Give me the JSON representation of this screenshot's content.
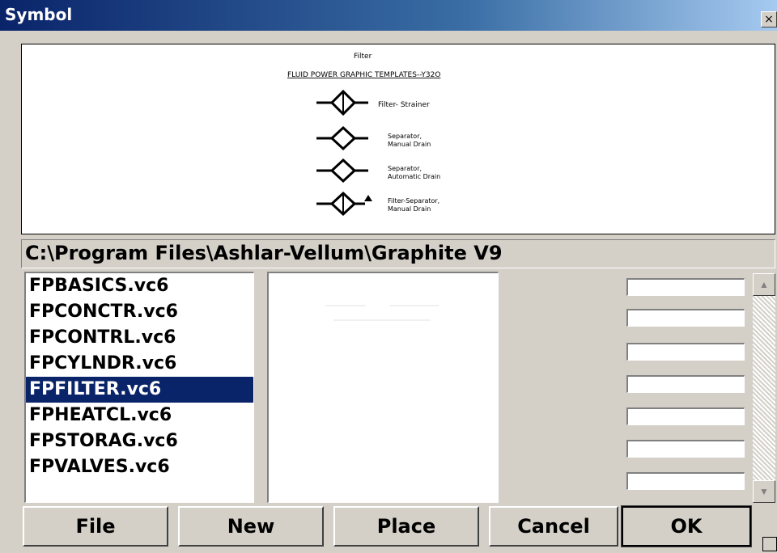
{
  "window": {
    "title": "Symbol",
    "close_label": "×"
  },
  "preview": {
    "heading": "Filter",
    "subheading": "FLUID POWER GRAPHIC TEMPLATES--Y32O",
    "symbols": [
      {
        "label_lines": [
          "Filter- Strainer"
        ]
      },
      {
        "label_lines": [
          "Separator,",
          "Manual Drain"
        ]
      },
      {
        "label_lines": [
          "Separator,",
          "Automatic Drain"
        ]
      },
      {
        "label_lines": [
          "Filter-Separator,",
          "Manual Drain"
        ]
      }
    ]
  },
  "path": "C:\\Program Files\\Ashlar-Vellum\\Graphite V9",
  "files": [
    {
      "name": "FPBASICS.vc6",
      "selected": false
    },
    {
      "name": "FPCONCTR.vc6",
      "selected": false
    },
    {
      "name": "FPCONTRL.vc6",
      "selected": false
    },
    {
      "name": "FPCYLNDR.vc6",
      "selected": false
    },
    {
      "name": "FPFILTER.vc6",
      "selected": true
    },
    {
      "name": "FPHEATCL.vc6",
      "selected": false
    },
    {
      "name": "FPSTORAG.vc6",
      "selected": false
    },
    {
      "name": "FPVALVES.vc6",
      "selected": false
    }
  ],
  "buttons": {
    "file": "File",
    "new": "New",
    "place": "Place",
    "cancel": "Cancel",
    "ok": "OK"
  }
}
